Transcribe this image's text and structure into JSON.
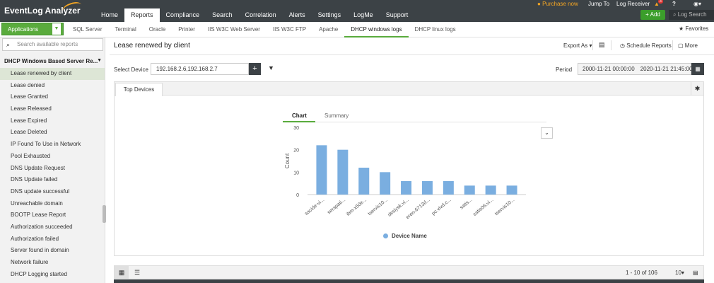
{
  "app": {
    "logo_text": "EventLog Analyzer"
  },
  "nav": {
    "items": [
      "Home",
      "Reports",
      "Compliance",
      "Search",
      "Correlation",
      "Alerts",
      "Settings",
      "LogMe",
      "Support"
    ],
    "active": "Reports"
  },
  "top_right": {
    "purchase": "Purchase now",
    "jump_to": "Jump To",
    "log_receiver": "Log Receiver",
    "notification_count": "3",
    "help": "?",
    "add_label": "+ Add",
    "log_search_placeholder": "Log Search"
  },
  "subbar": {
    "applications_label": "Applications",
    "tabs": [
      "SQL Server",
      "Terminal",
      "Oracle",
      "Printer",
      "IIS W3C Web Server",
      "IIS W3C FTP",
      "Apache",
      "DHCP windows logs",
      "DHCP linux logs"
    ],
    "active_tab": "DHCP windows logs",
    "favorites_label": "Favorites"
  },
  "sidebar": {
    "search_placeholder": "Search available reports",
    "section_title": "DHCP Windows Based Server Re...",
    "items": [
      "Lease renewed by client",
      "Lease denied",
      "Lease Granted",
      "Lease Released",
      "Lease Expired",
      "Lease Deleted",
      "IP Found To Use in Network",
      "Pool Exhausted",
      "DNS Update Request",
      "DNS Update failed",
      "DNS update successful",
      "Unreachable domain",
      "BOOTP Lease Report",
      "Authorization succeeded",
      "Authorization failed",
      "Server found in domain",
      "Network failure",
      "DHCP Logging started"
    ],
    "active_index": 0
  },
  "main": {
    "title": "Lease renewed by client",
    "export_label": "Export As",
    "schedule_label": "Schedule Reports",
    "more_label": "More",
    "select_device_label": "Select Device",
    "select_device_value": "192.168.2.6,192.168.2.7",
    "period_label": "Period",
    "period_from": "2000-11-21 00:00:00",
    "period_to": "2020-11-21 21:45:00",
    "panel_tab": "Top Devices",
    "chart_tabs": {
      "chart": "Chart",
      "summary": "Summary"
    },
    "pagination": "1 - 10 of 106",
    "per_page": "10"
  },
  "icons": {
    "search": "search-icon",
    "gear": "gear-icon",
    "calendar": "calendar-icon",
    "filter": "filter-icon",
    "star": "star-icon",
    "bell": "bell-icon",
    "user": "user-icon"
  },
  "colors": {
    "nav_bg": "#3c4246",
    "accent_green": "#5aab3d",
    "bar_color": "#7aaee0",
    "purchase_orange": "#f5a623"
  },
  "chart_data": {
    "type": "bar",
    "categories": [
      "sacide-vi...",
      "serapati...",
      "ibm-x50e...",
      "tservis10...",
      "desiysk.vi...",
      "eren-6713d...",
      "pc.vivd.c...",
      "satis...",
      "satis06.vi...",
      "tservis10..."
    ],
    "values": [
      22,
      20,
      12,
      10,
      6,
      6,
      6,
      4,
      4,
      4
    ],
    "ylabel": "Count",
    "xlabel": "",
    "ylim": [
      0,
      30
    ],
    "yticks": [
      0,
      10,
      20,
      30
    ],
    "legend": [
      "Device Name"
    ],
    "legend_position": "bottom",
    "grid": false
  }
}
